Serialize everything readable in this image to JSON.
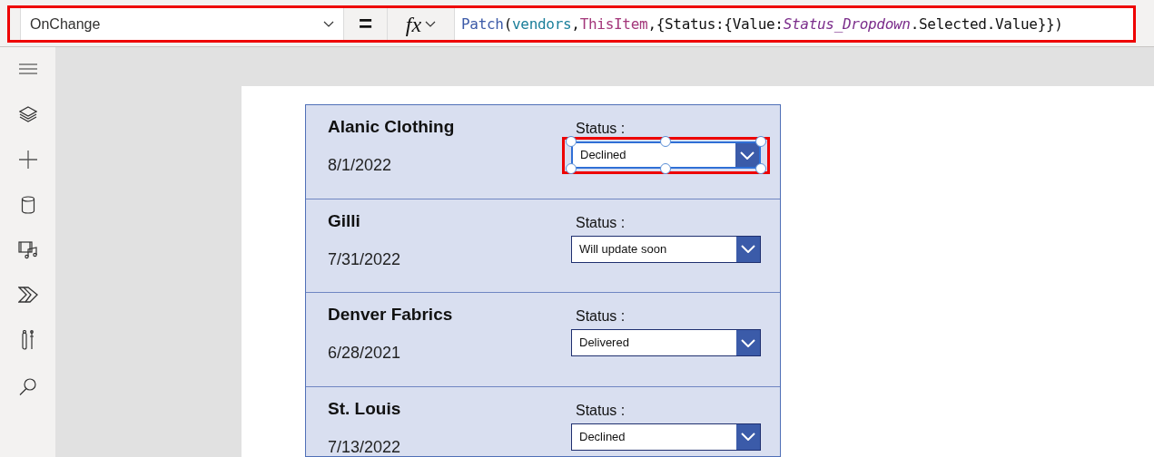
{
  "formula_bar": {
    "property": "OnChange",
    "equals": "=",
    "fx": "fx",
    "formula": [
      {
        "kind": "function",
        "text": "Patch"
      },
      {
        "kind": "plain",
        "text": "("
      },
      {
        "kind": "datasource",
        "text": "vendors"
      },
      {
        "kind": "plain",
        "text": ","
      },
      {
        "kind": "keyword",
        "text": "ThisItem"
      },
      {
        "kind": "plain",
        "text": ",{Status:{Value:"
      },
      {
        "kind": "control",
        "text": "Status_Dropdown"
      },
      {
        "kind": "plain",
        "text": ".Selected.Value}})"
      }
    ]
  },
  "gallery": {
    "rows": [
      {
        "name": "Alanic Clothing",
        "date": "8/1/2022",
        "status_label": "Status :",
        "status": "Declined",
        "selected": true
      },
      {
        "name": "Gilli",
        "date": "7/31/2022",
        "status_label": "Status :",
        "status": "Will update soon",
        "selected": false
      },
      {
        "name": "Denver Fabrics",
        "date": "6/28/2021",
        "status_label": "Status :",
        "status": "Delivered",
        "selected": false
      },
      {
        "name": "St. Louis",
        "date": "7/13/2022",
        "status_label": "Status :",
        "status": "Declined",
        "selected": false
      }
    ]
  }
}
